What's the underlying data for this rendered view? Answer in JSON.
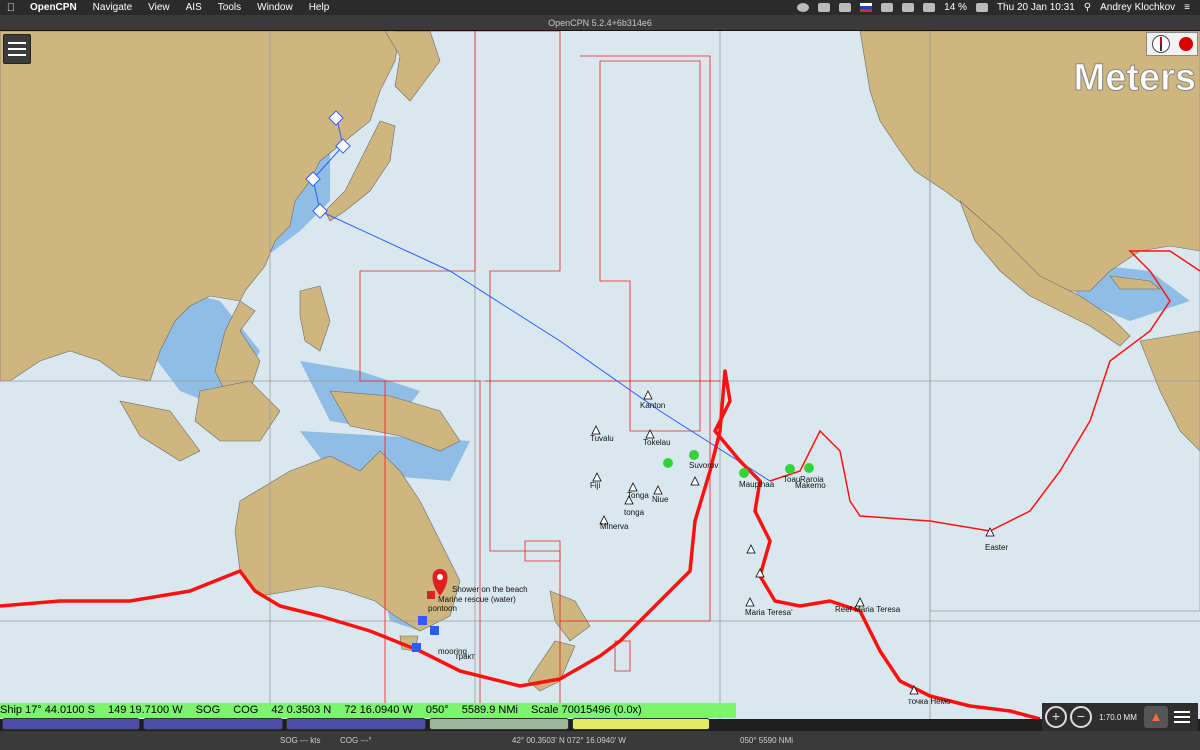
{
  "menubar": {
    "app_name": "OpenCPN",
    "items": [
      "Navigate",
      "View",
      "AIS",
      "Tools",
      "Window",
      "Help"
    ],
    "battery": "14 %",
    "datetime": "Thu 20 Jan  10:31",
    "user": "Andrey Klochkov"
  },
  "window": {
    "title": "OpenCPN 5.2.4+6b314e6"
  },
  "chart": {
    "units_overlay": "Meters",
    "places": {
      "kanton": "Kanton",
      "tokelau": "Tokelau",
      "tuvalu": "Tuvalu",
      "suvorov": "Suvorov",
      "maupihaa": "Maupihaa",
      "toau": "Toau",
      "raroia": "Raroia",
      "makemo": "Makemo",
      "tonga1": "Tonga",
      "tonga2": "tonga",
      "niue": "Niue",
      "fiji": "Fiji",
      "minerva": "Minerva",
      "easter": "Easter",
      "maria_teresa": "Maria Teresa'",
      "reef_maria_teresa": "Reef Maria Teresa",
      "nemo": "точка Немо",
      "shower": "Shower on the beach",
      "marine_rescue": "Marine rescue (water)",
      "pontoon": "pontoon",
      "mooring": "mooring",
      "trail": "тракт"
    }
  },
  "statusbar": {
    "ship": "Ship 17° 44.0100 S",
    "lon": "149 19.7100 W",
    "sog": "SOG",
    "cog": "COG",
    "cursor_lat": "42 0.3503 N",
    "cursor_lon": "72 16.0940 W",
    "bearing": "050°",
    "distance": "5589.9 NMi",
    "scale": "Scale 70015496 (0.0x)"
  },
  "zoom": {
    "scale_readout": "1:70.0 MM"
  },
  "bottombar": {
    "sog": "SOG --- kts",
    "cog": "COG ---°",
    "position": "42° 00.3503' N   072° 16.0940' W",
    "brg_dist": "050°  5590 NMi"
  },
  "colors": {
    "sea": "#d9e8ee",
    "land": "#cfb57e",
    "shallow": "#8fbde6",
    "route": "#ee1c1c",
    "status_green": "#7cf46e"
  }
}
